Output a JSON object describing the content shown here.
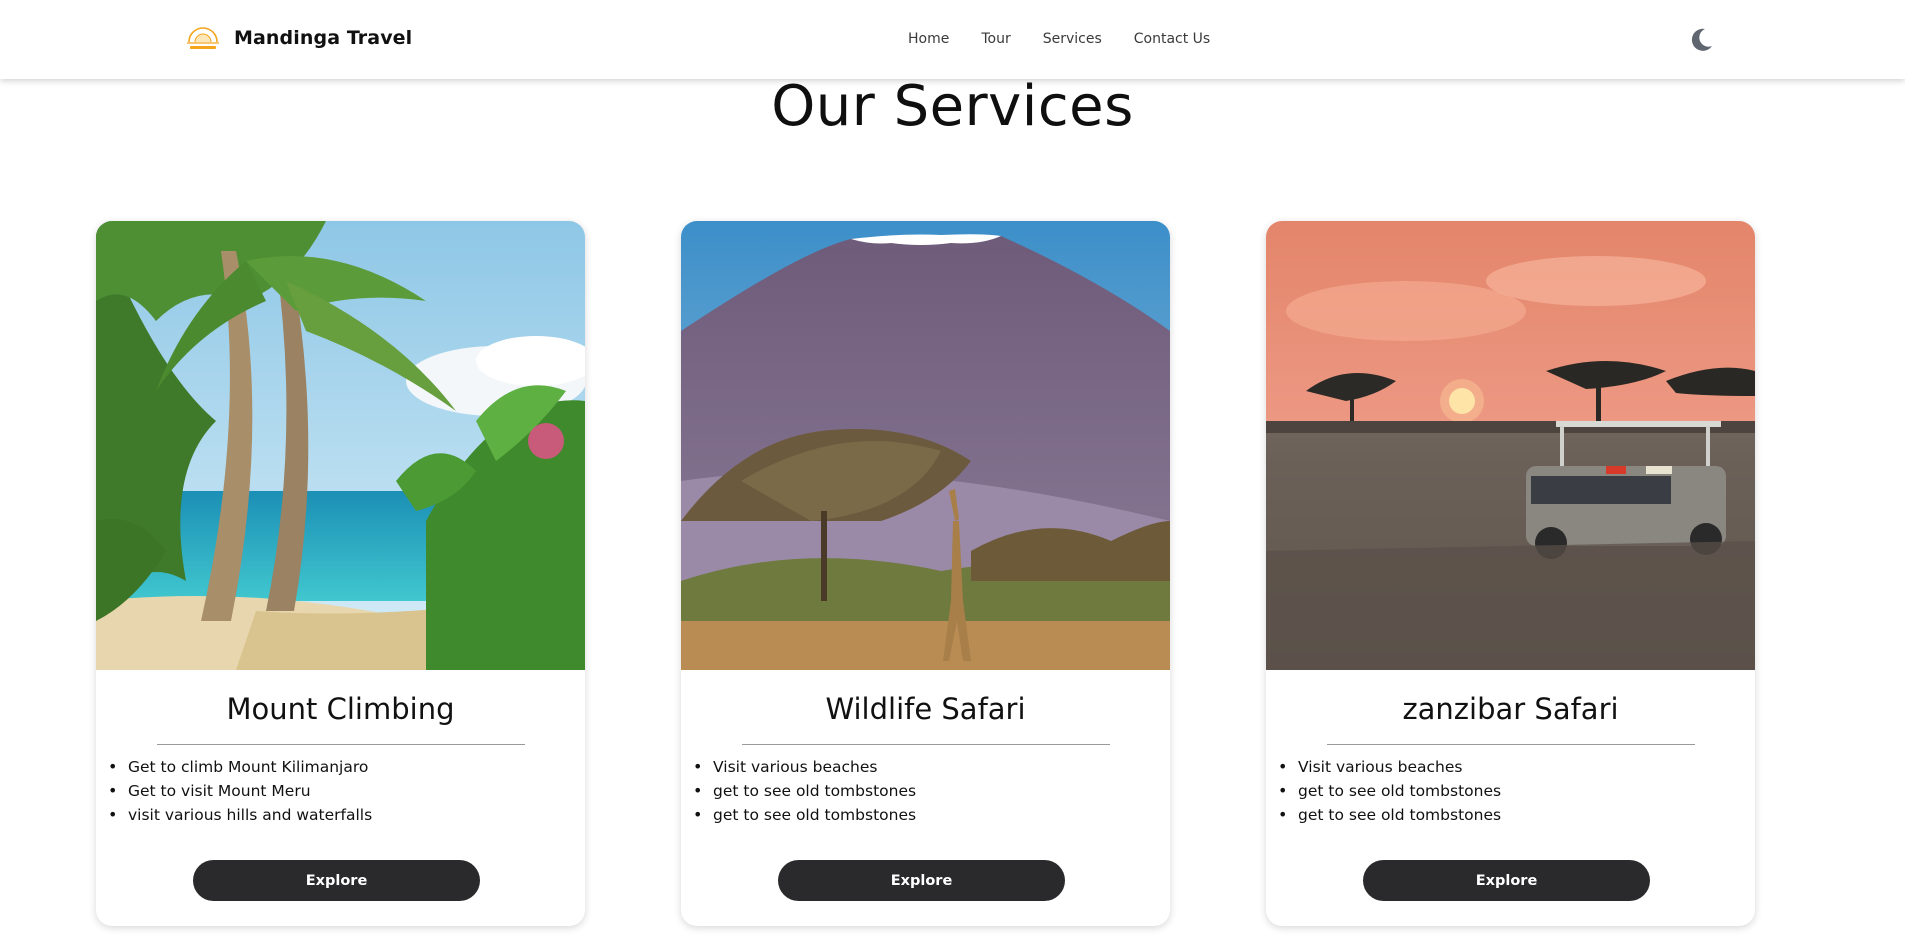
{
  "header": {
    "brand_name": "Mandinga Travel",
    "logo_icon": "sunrise-logo-icon",
    "nav": [
      {
        "label": "Home"
      },
      {
        "label": "Tour"
      },
      {
        "label": "Services"
      },
      {
        "label": "Contact Us"
      }
    ],
    "theme_toggle_icon": "moon-icon"
  },
  "page": {
    "title": "Our Services"
  },
  "cards": [
    {
      "title": "Mount Climbing",
      "image": "beach-palm-trees-image",
      "items": [
        "Get to climb Mount Kilimanjaro",
        "Get to visit Mount Meru",
        "visit various hills and waterfalls"
      ],
      "button_label": "Explore"
    },
    {
      "title": "Wildlife Safari",
      "image": "kilimanjaro-giraffe-image",
      "items": [
        "Visit various beaches",
        "get to see old tombstones",
        "get to see old tombstones"
      ],
      "button_label": "Explore"
    },
    {
      "title": "zanzibar Safari",
      "image": "sunset-safari-jeep-image",
      "items": [
        "Visit various beaches",
        "get to see old tombstones",
        "get to see old tombstones"
      ],
      "button_label": "Explore"
    }
  ],
  "colors": {
    "button_bg": "#2a2a2c",
    "logo_orange": "#f4a51c",
    "moon": "#5f6670"
  }
}
